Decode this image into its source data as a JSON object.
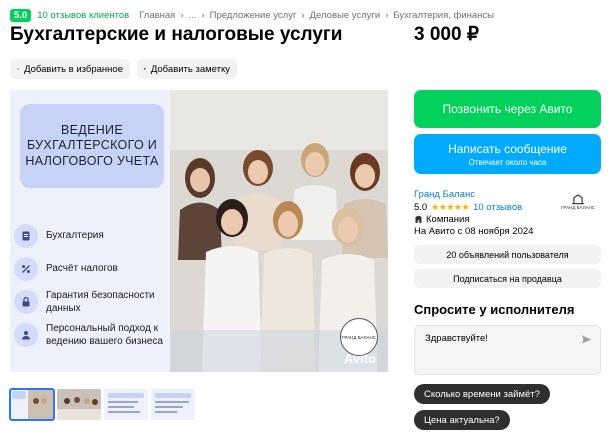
{
  "header": {
    "rating": "5.0",
    "reviews_link": "10 отзывов клиентов",
    "breadcrumbs": [
      "Главная",
      "...",
      "Предложение услуг",
      "Деловые услуги",
      "Бухгалтерия, финансы"
    ],
    "title": "Бухгалтерские и налоговые услуги",
    "price": "3 000 ₽",
    "add_favorite": "Добавить в избранное",
    "add_note": "Добавить заметку"
  },
  "image": {
    "heading": "ВЕДЕНИЕ БУХГАЛТЕРСКОГО И НАЛОГОВОГО УЧЕТА",
    "features": [
      "Бухгалтерия",
      "Расчёт налогов",
      "Гарантия безопасности данных",
      "Персональный подход к ведению вашего бизнеса"
    ],
    "stamp_text": "ГРАНД БАЛАНС",
    "watermark": "Avito",
    "thumbnails": 4,
    "active_thumbnail": 1
  },
  "actions": {
    "call": "Позвонить через Авито",
    "message": "Написать сообщение",
    "message_sub": "Отвечает около часа"
  },
  "seller": {
    "name": "Гранд Баланс",
    "rating": "5.0",
    "stars": "★★★★★",
    "reviews": "10 отзывов",
    "type": "Компания",
    "since": "На Авито с 08 ноября 2024",
    "logo_text": "ГРАНД БАЛАНС",
    "ads_count": "20 объявлений пользователя",
    "subscribe": "Подписаться на продавца"
  },
  "ask": {
    "title": "Спросите у исполнителя",
    "message": "Здравствуйте!",
    "quick_questions": [
      "Сколько времени займёт?",
      "Цена актуальна?"
    ]
  },
  "colors": {
    "green": "#02d15c",
    "blue": "#00aaff",
    "link": "#0a7bd6"
  }
}
